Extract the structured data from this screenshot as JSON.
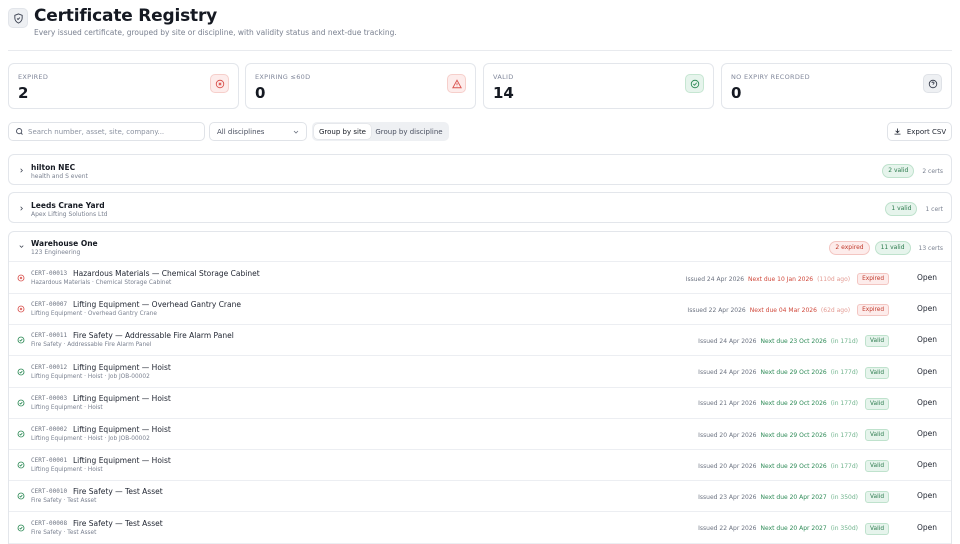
{
  "header": {
    "title": "Certificate Registry",
    "subtitle": "Every issued certificate, grouped by site or discipline, with validity status and next-due tracking."
  },
  "stats": [
    {
      "label": "Expired",
      "value": "2",
      "icon": "x-circle-icon",
      "color": "#d9534f",
      "bg": "#fdeceb"
    },
    {
      "label": "Expiring ≤60d",
      "value": "0",
      "icon": "warning-triangle-icon",
      "color": "#d9534f",
      "bg": "#fdeceb"
    },
    {
      "label": "Valid",
      "value": "14",
      "icon": "check-circle-icon",
      "color": "#2e8b57",
      "bg": "#e6f4ec"
    },
    {
      "label": "No expiry recorded",
      "value": "0",
      "icon": "help-circle-icon",
      "color": "#4a5060",
      "bg": "#eef0f3"
    }
  ],
  "toolbar": {
    "search_placeholder": "Search number, asset, site, company...",
    "discipline_select": "All disciplines",
    "group_by_site": "Group by site",
    "group_by_discipline": "Group by discipline",
    "export": "Export CSV"
  },
  "groups": [
    {
      "name": "hilton NEC",
      "sub": "health and S event",
      "valid": "2 valid",
      "count": "2 certs"
    },
    {
      "name": "Leeds Crane Yard",
      "sub": "Apex Lifting Solutions Ltd",
      "valid": "1 valid",
      "count": "1 cert"
    }
  ],
  "warehouse": {
    "name": "Warehouse One",
    "sub": "123 Engineering",
    "expired": "2 expired",
    "valid": "11 valid",
    "count": "13 certs"
  },
  "rows": [
    {
      "status": "expired",
      "code": "CERT-00013",
      "title": "Hazardous Materials — Chemical Storage Cabinet",
      "sub": "Hazardous Materials · Chemical Storage Cabinet",
      "issued": "Issued 24 Apr 2026",
      "next": "Next due 10 Jan 2026",
      "rel": "(110d ago)",
      "badge": "Expired",
      "open": "Open"
    },
    {
      "status": "expired",
      "code": "CERT-00007",
      "title": "Lifting Equipment — Overhead Gantry Crane",
      "sub": "Lifting Equipment · Overhead Gantry Crane",
      "issued": "Issued 22 Apr 2026",
      "next": "Next due 04 Mar 2026",
      "rel": "(62d ago)",
      "badge": "Expired",
      "open": "Open"
    },
    {
      "status": "valid",
      "code": "CERT-00011",
      "title": "Fire Safety — Addressable Fire Alarm Panel",
      "sub": "Fire Safety · Addressable Fire Alarm Panel",
      "issued": "Issued 24 Apr 2026",
      "next": "Next due 23 Oct 2026",
      "rel": "(in 171d)",
      "badge": "Valid",
      "open": "Open"
    },
    {
      "status": "valid",
      "code": "CERT-00012",
      "title": "Lifting Equipment — Hoist",
      "sub": "Lifting Equipment · Hoist · Job JOB-00002",
      "issued": "Issued 24 Apr 2026",
      "next": "Next due 29 Oct 2026",
      "rel": "(in 177d)",
      "badge": "Valid",
      "open": "Open"
    },
    {
      "status": "valid",
      "code": "CERT-00003",
      "title": "Lifting Equipment — Hoist",
      "sub": "Lifting Equipment · Hoist",
      "issued": "Issued 21 Apr 2026",
      "next": "Next due 29 Oct 2026",
      "rel": "(in 177d)",
      "badge": "Valid",
      "open": "Open"
    },
    {
      "status": "valid",
      "code": "CERT-00002",
      "title": "Lifting Equipment — Hoist",
      "sub": "Lifting Equipment · Hoist · Job JOB-00002",
      "issued": "Issued 20 Apr 2026",
      "next": "Next due 29 Oct 2026",
      "rel": "(in 177d)",
      "badge": "Valid",
      "open": "Open"
    },
    {
      "status": "valid",
      "code": "CERT-00001",
      "title": "Lifting Equipment — Hoist",
      "sub": "Lifting Equipment · Hoist",
      "issued": "Issued 20 Apr 2026",
      "next": "Next due 29 Oct 2026",
      "rel": "(in 177d)",
      "badge": "Valid",
      "open": "Open"
    },
    {
      "status": "valid",
      "code": "CERT-00010",
      "title": "Fire Safety — Test Asset",
      "sub": "Fire Safety · Test Asset",
      "issued": "Issued 23 Apr 2026",
      "next": "Next due 20 Apr 2027",
      "rel": "(in 350d)",
      "badge": "Valid",
      "open": "Open"
    },
    {
      "status": "valid",
      "code": "CERT-00008",
      "title": "Fire Safety — Test Asset",
      "sub": "Fire Safety · Test Asset",
      "issued": "Issued 22 Apr 2026",
      "next": "Next due 20 Apr 2027",
      "rel": "(in 350d)",
      "badge": "Valid",
      "open": "Open"
    }
  ]
}
